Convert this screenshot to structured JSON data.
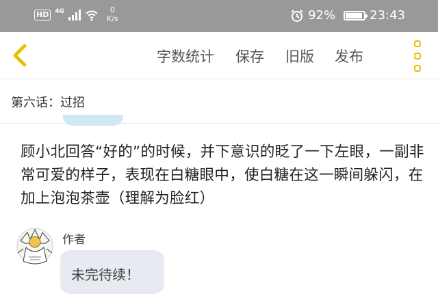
{
  "status_bar": {
    "network_badge": "HD",
    "network_type": "4G",
    "signal_bars": 4,
    "speed_value": "0",
    "speed_unit": "K/s",
    "battery_percent": "92%",
    "battery_level": 0.92,
    "time": "23:43"
  },
  "toolbar": {
    "back_icon": "chevron-left-icon",
    "word_count_label": "字数统计",
    "save_label": "保存",
    "old_version_label": "旧版",
    "publish_label": "发布",
    "more_icon": "more-vertical-icon",
    "accent_color": "#e6c200"
  },
  "chapter": {
    "title": "第六话：过招"
  },
  "content": {
    "paragraph": "顾小北回答“好的”的时候，并下意识的眨了一下左眼，一副非常可爱的样子，表现在白糖眼中，使白糖在这一瞬间躲闪，在加上泡泡茶壶（理解为脸红）"
  },
  "message": {
    "author_label": "作者",
    "text": "未完待续！",
    "bubble_color": "#e7eaf0"
  },
  "colors": {
    "status_bar_bg": "#999999",
    "prev_bubble": "#cfe8f4"
  }
}
